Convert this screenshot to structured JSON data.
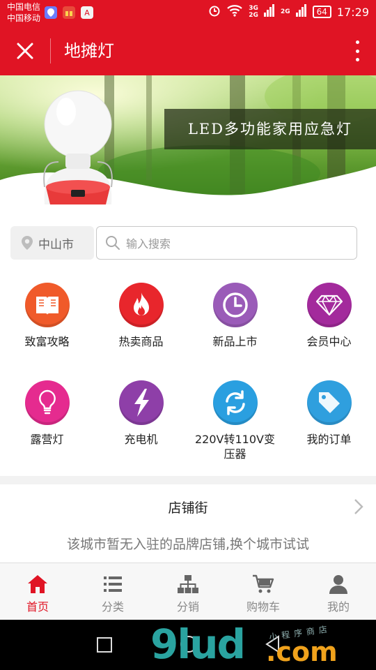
{
  "status_bar": {
    "carrier1": "中国电信",
    "carrier2": "中国移动",
    "net1": "3G",
    "net2": "2G",
    "net3": "2G",
    "battery": "64",
    "time": "17:29",
    "mini_icon_label": "A"
  },
  "app_bar": {
    "title": "地摊灯"
  },
  "banner": {
    "caption": "LED多功能家用应急灯"
  },
  "search": {
    "city": "中山市",
    "placeholder": "输入搜索"
  },
  "categories": [
    {
      "label": "致富攻略",
      "icon": "book-icon",
      "color": "#f05a2a"
    },
    {
      "label": "热卖商品",
      "icon": "fire-icon",
      "color": "#e8262c"
    },
    {
      "label": "新品上市",
      "icon": "clock-icon",
      "color": "#9a5bb8"
    },
    {
      "label": "会员中心",
      "icon": "diamond-icon",
      "color": "#a32a9c"
    },
    {
      "label": "露营灯",
      "icon": "lightbulb-icon",
      "color": "#e52b8f"
    },
    {
      "label": "充电机",
      "icon": "lightning-icon",
      "color": "#8e3fa8"
    },
    {
      "label": "220V转110V变压器",
      "icon": "refresh-icon",
      "color": "#2a9fe0"
    },
    {
      "label": "我的订单",
      "icon": "tag-icon",
      "color": "#2f9fde"
    }
  ],
  "shop_street": {
    "title": "店铺街",
    "empty_message": "该城市暂无入驻的品牌店铺,换个城市试试"
  },
  "bottom_nav": [
    {
      "label": "首页",
      "icon": "home-icon",
      "active": true
    },
    {
      "label": "分类",
      "icon": "list-icon",
      "active": false
    },
    {
      "label": "分销",
      "icon": "hierarchy-icon",
      "active": false
    },
    {
      "label": "购物车",
      "icon": "cart-icon",
      "active": false
    },
    {
      "label": "我的",
      "icon": "user-icon",
      "active": false
    }
  ],
  "watermark": {
    "main": "9lud",
    "suffix": ".com",
    "small": "小程序商店"
  },
  "colors": {
    "brand_red": "#e01424",
    "watermark_teal": "#2aa3a0",
    "watermark_orange": "#f0a21c"
  }
}
